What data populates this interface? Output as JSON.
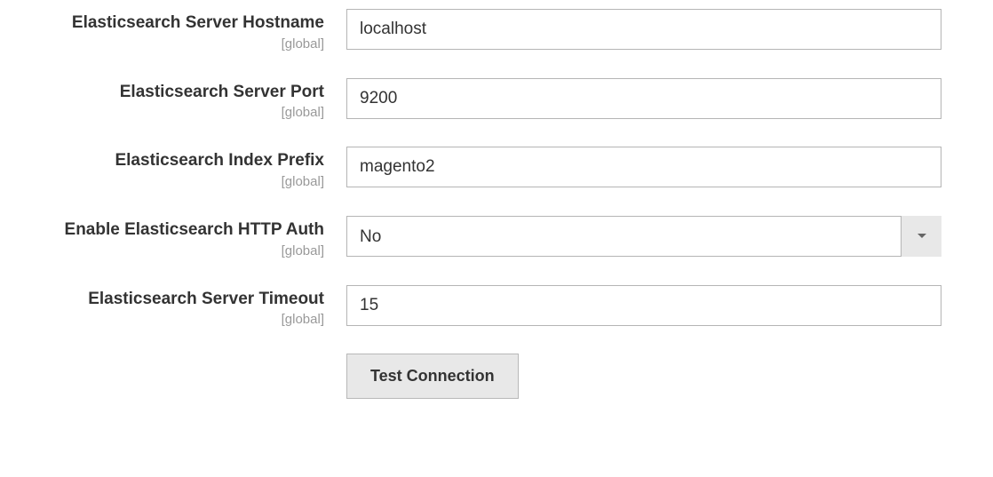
{
  "scope_text": "[global]",
  "fields": {
    "hostname": {
      "label": "Elasticsearch Server Hostname",
      "value": "localhost"
    },
    "port": {
      "label": "Elasticsearch Server Port",
      "value": "9200"
    },
    "index_prefix": {
      "label": "Elasticsearch Index Prefix",
      "value": "magento2"
    },
    "http_auth": {
      "label": "Enable Elasticsearch HTTP Auth",
      "value": "No"
    },
    "timeout": {
      "label": "Elasticsearch Server Timeout",
      "value": "15"
    }
  },
  "test_button": "Test Connection"
}
